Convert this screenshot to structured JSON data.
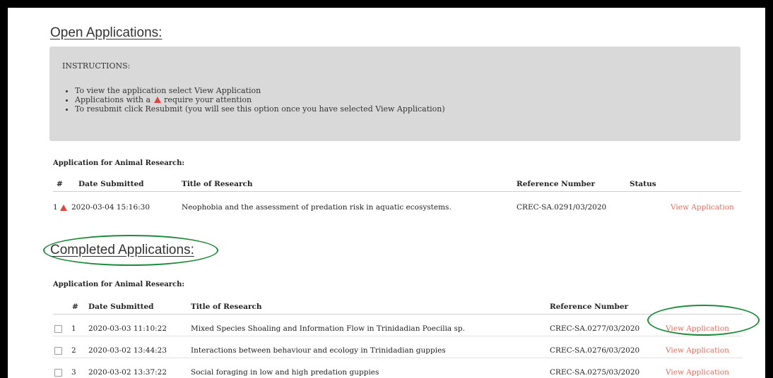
{
  "open": {
    "title": "Open Applications:",
    "instructions": {
      "heading": "INSTRUCTIONS:",
      "item1": "To view the application select View Application",
      "item2_before": "Applications with a",
      "item2_after": "require your attention",
      "item3": "To resubmit click Resubmit (you will see this option once you have selected View Application)"
    },
    "table_caption": "Application for Animal Research:",
    "columns": {
      "num": "#",
      "date": "Date Submitted",
      "title": "Title of Research",
      "ref": "Reference Number",
      "status": "Status"
    },
    "rows": [
      {
        "num": "1",
        "date": "2020-03-04 15:16:30",
        "title": "Neophobia and the assessment of predation risk in aquatic ecosystems.",
        "ref": "CREC-SA.0291/03/2020",
        "action": "View Application"
      }
    ]
  },
  "completed": {
    "title": "Completed Applications:",
    "table_caption": "Application for Animal Research:",
    "columns": {
      "num": "#",
      "date": "Date Submitted",
      "title": "Title of Research",
      "ref": "Reference Number"
    },
    "rows": [
      {
        "num": "1",
        "date": "2020-03-03 11:10:22",
        "title": "Mixed Species Shoaling and Information Flow in Trinidadian Poecilia sp.",
        "ref": "CREC-SA.0277/03/2020",
        "action": "View Application"
      },
      {
        "num": "2",
        "date": "2020-03-02 13:44:23",
        "title": "Interactions between behaviour and ecology in Trinidadian guppies",
        "ref": "CREC-SA.0276/03/2020",
        "action": "View Application"
      },
      {
        "num": "3",
        "date": "2020-03-02 13:37:22",
        "title": "Social foraging in low and high predation guppies",
        "ref": "CREC-SA.0275/03/2020",
        "action": "View Application"
      }
    ]
  },
  "colors": {
    "link": "#ef6b5a",
    "warning": "#e0443c",
    "annotation": "#1e8a3c",
    "panel": "#d9d9d9"
  },
  "icons": {
    "warning": "warning-triangle-icon",
    "checkbox": "checkbox-icon"
  }
}
